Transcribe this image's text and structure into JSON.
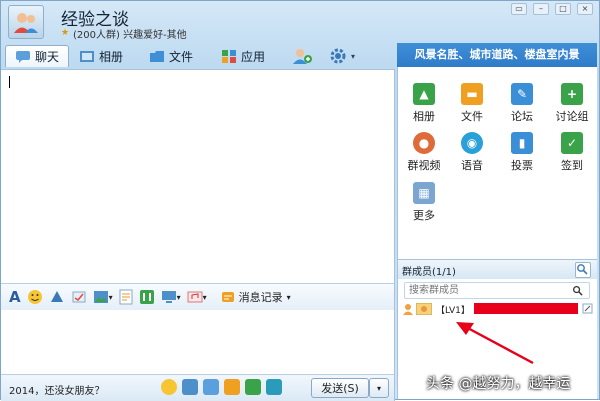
{
  "header": {
    "title": "经验之谈",
    "subtitle": "(200人群) 兴趣爱好-其他"
  },
  "tabs": [
    {
      "label": "聊天",
      "icon": "chat-icon"
    },
    {
      "label": "相册",
      "icon": "album-icon"
    },
    {
      "label": "文件",
      "icon": "folder-icon"
    },
    {
      "label": "应用",
      "icon": "apps-icon"
    }
  ],
  "banner": {
    "text": "风景名胜、城市道路、楼盘室内景"
  },
  "apps": [
    {
      "label": "相册",
      "icon": "photo-icon",
      "color": "#3aa34a"
    },
    {
      "label": "文件",
      "icon": "folder-icon",
      "color": "#f0a020"
    },
    {
      "label": "论坛",
      "icon": "forum-icon",
      "color": "#3b8fd6"
    },
    {
      "label": "讨论组",
      "icon": "discussion-icon",
      "color": "#3aa34a"
    },
    {
      "label": "群视频",
      "icon": "video-icon",
      "color": "#e06b3a"
    },
    {
      "label": "语音",
      "icon": "voice-icon",
      "color": "#2aa0d8"
    },
    {
      "label": "投票",
      "icon": "vote-icon",
      "color": "#3b8fd6"
    },
    {
      "label": "签到",
      "icon": "checkin-icon",
      "color": "#3aa34a"
    },
    {
      "label": "更多",
      "icon": "more-icon",
      "color": "#7aa6cf"
    }
  ],
  "members": {
    "title": "群成员(1/1)",
    "search_placeholder": "搜索群成员",
    "first_member_level": "【LV1】"
  },
  "format_bar": {
    "message_record": "消息记录"
  },
  "input": {
    "text": "2014，还没女朋友？"
  },
  "send": {
    "label": "发送(S)"
  },
  "watermark": {
    "text": "头条 @越努力，越幸运"
  },
  "colors": {
    "accent": "#2f7bc8",
    "redact": "#e8001a",
    "arrow": "#e8001a"
  }
}
